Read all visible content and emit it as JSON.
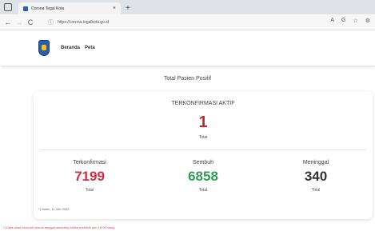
{
  "browser": {
    "tab_title": "Corona Tegal Kota",
    "tab_close": "×",
    "new_tab": "+",
    "url": "https://corona.tegalkota.go.id",
    "nav": {
      "back": "←",
      "forward": "→",
      "reload": "C"
    },
    "tools": [
      "A",
      "G",
      "☆",
      "⚙"
    ]
  },
  "site": {
    "menu": [
      "Beranda",
      "Peta"
    ]
  },
  "page_title": "Total Pasien Positif",
  "active": {
    "title": "TERKONFIRMASI AKTIF",
    "value": "1",
    "label": "Total"
  },
  "stats": [
    {
      "title": "Terkonfirmasi",
      "value": "7199",
      "label": "Total",
      "color": "#d12d43"
    },
    {
      "title": "Sembuh",
      "value": "6858",
      "label": "Total",
      "color": "#2e9c55"
    },
    {
      "title": "Meninggal",
      "value": "340",
      "label": "Total",
      "color": "#333333"
    }
  ],
  "updated_note": "*) Sabtu, 11 Mei 2022",
  "footnote": "*) Data akan berubah sesuai tanggal sekarang ketika melebihi jam 16:00 siang."
}
